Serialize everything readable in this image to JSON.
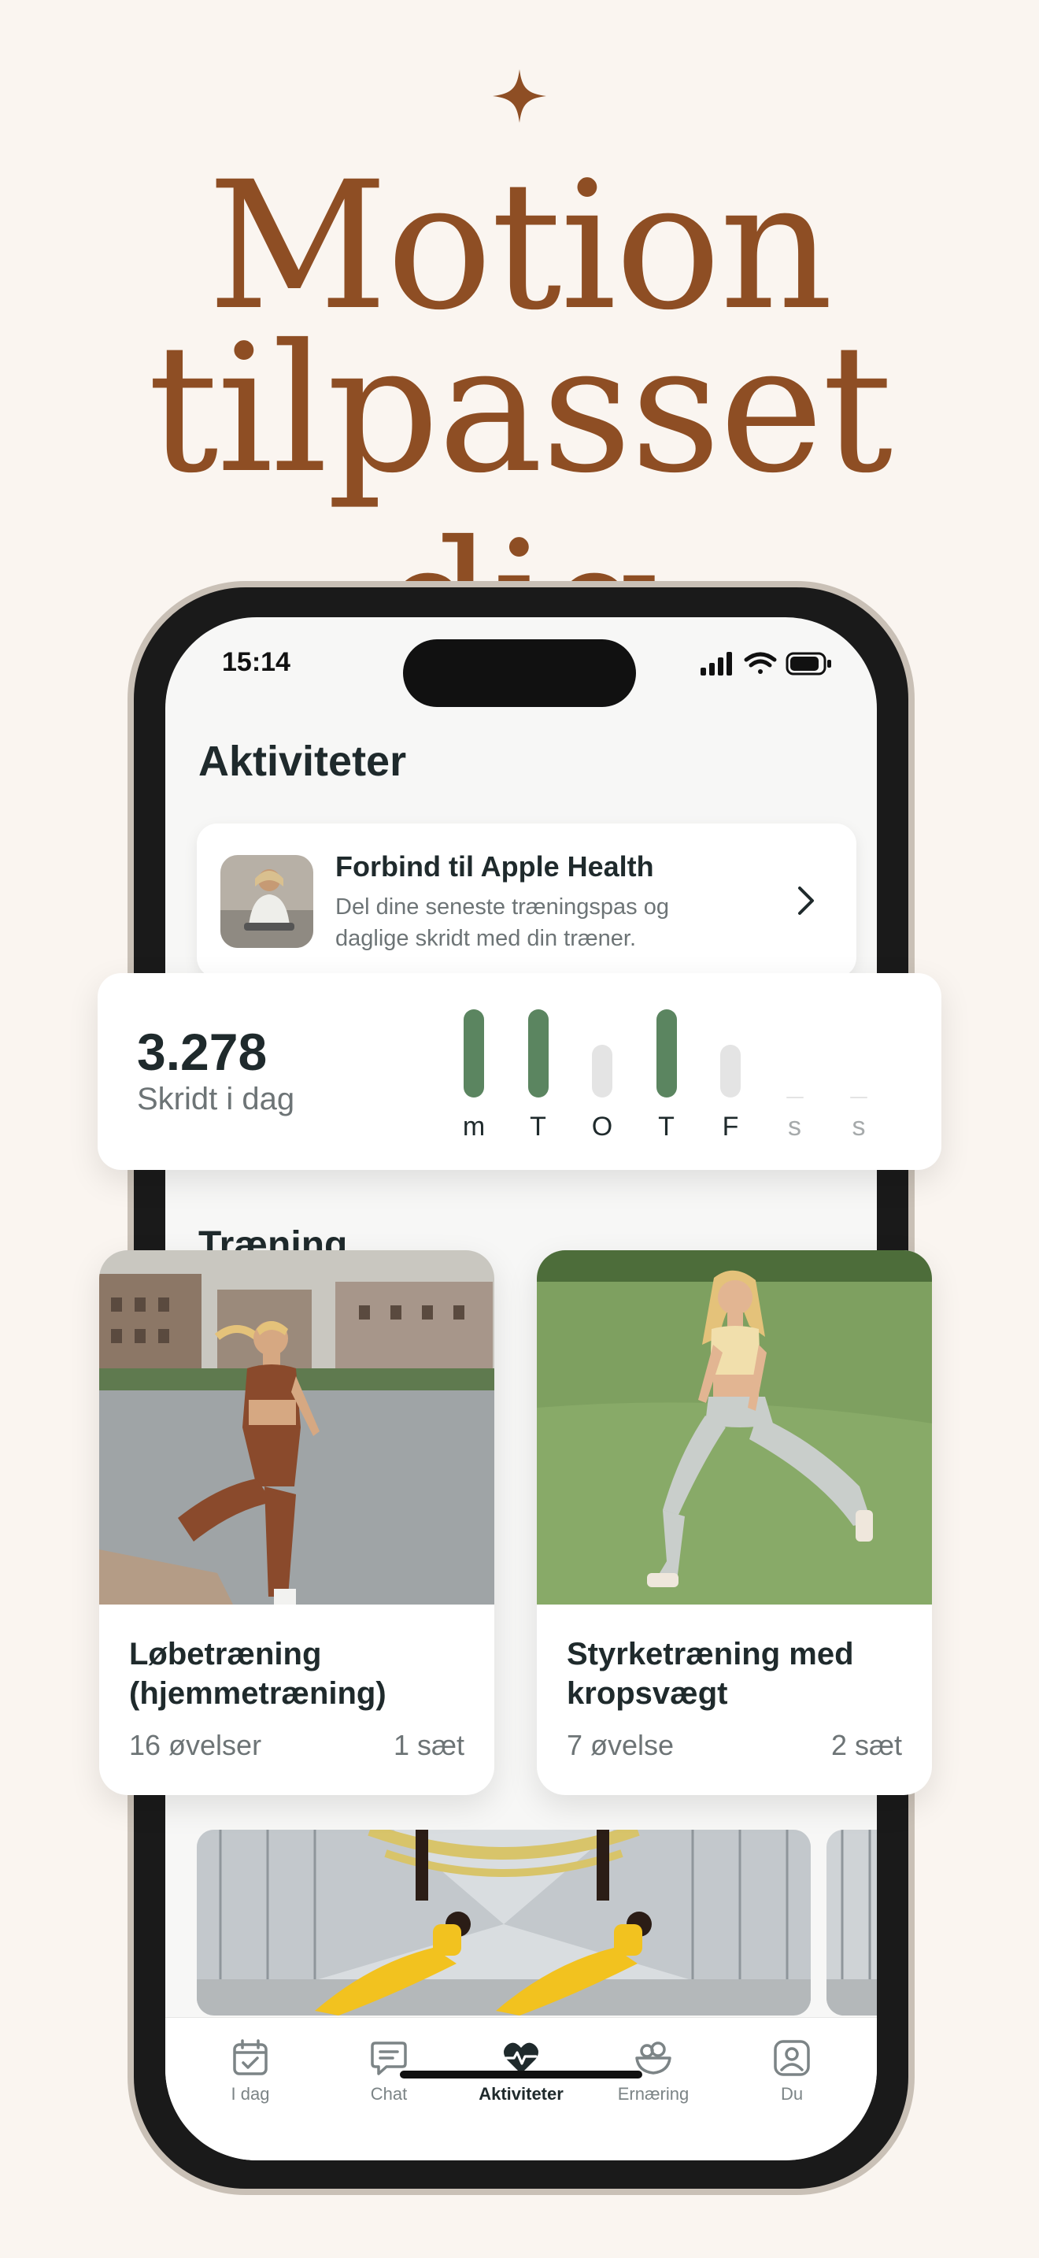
{
  "hero": {
    "line1": "Motion",
    "line2": "tilpasset dig"
  },
  "colors": {
    "brand": "#8e4e24",
    "bar_active": "#5b8560",
    "bar_inactive": "#e4e4e4",
    "background": "#faf5f0"
  },
  "status_bar": {
    "time": "15:14"
  },
  "screen": {
    "title": "Aktiviteter"
  },
  "health_card": {
    "title": "Forbind til Apple Health",
    "subtitle": "Del dine seneste træningspas og daglige skridt med din træner."
  },
  "steps": {
    "value": "3.278",
    "label": "Skridt i dag",
    "days": [
      {
        "label": "m",
        "level": 1.0,
        "state": "active"
      },
      {
        "label": "T",
        "level": 1.0,
        "state": "active"
      },
      {
        "label": "O",
        "level": 0.6,
        "state": "inactive"
      },
      {
        "label": "T",
        "level": 1.0,
        "state": "active"
      },
      {
        "label": "F",
        "level": 0.6,
        "state": "inactive"
      },
      {
        "label": "s",
        "level": 0.0,
        "state": "empty"
      },
      {
        "label": "s",
        "level": 0.0,
        "state": "empty"
      }
    ]
  },
  "section": {
    "training_title": "Træning"
  },
  "workouts": [
    {
      "title": "Løbetræning (hjemmetræning)",
      "exercises": "16 øvelser",
      "sets": "1 sæt"
    },
    {
      "title": "Styrketræning med kropsvægt",
      "exercises": "7 øvelse",
      "sets": "2 sæt"
    }
  ],
  "tabbar": [
    {
      "label": "I dag",
      "icon": "calendar-check-icon"
    },
    {
      "label": "Chat",
      "icon": "chat-icon"
    },
    {
      "label": "Aktiviteter",
      "icon": "heart-pulse-icon",
      "active": true
    },
    {
      "label": "Ernæring",
      "icon": "food-bowl-icon"
    },
    {
      "label": "Du",
      "icon": "profile-icon"
    }
  ]
}
